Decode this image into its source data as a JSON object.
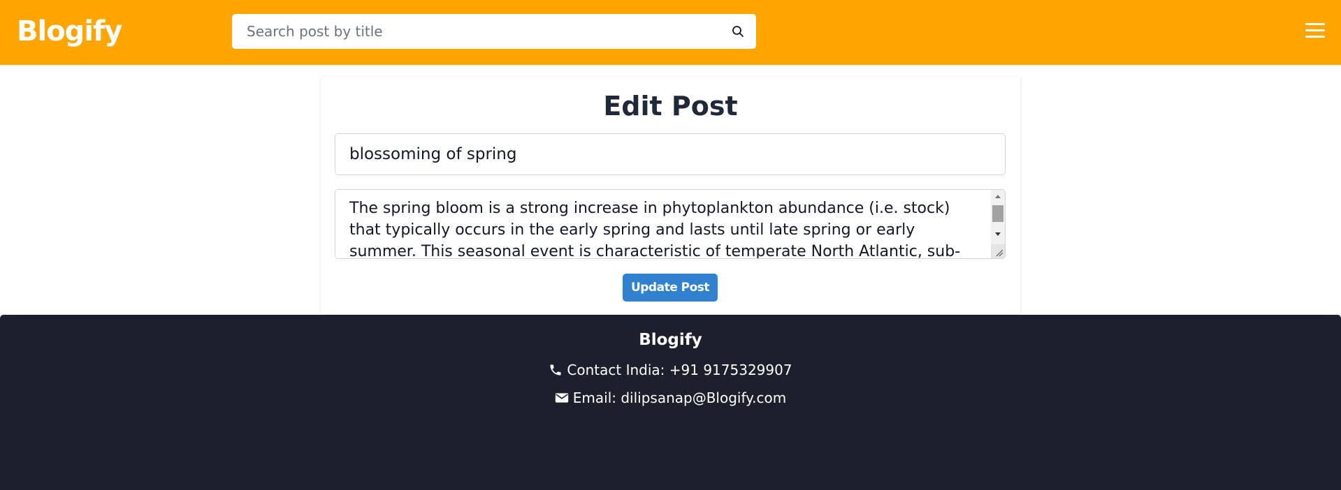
{
  "header": {
    "logo": "Blogify",
    "search_placeholder": "Search post by title",
    "icons": {
      "search": "search-icon",
      "menu": "hamburger-menu-icon"
    }
  },
  "edit_form": {
    "heading": "Edit Post",
    "title_value": "blossoming of spring",
    "content_value": "The spring bloom is a strong increase in phytoplankton abundance (i.e. stock) that typically occurs in the early spring and lasts until late spring or early summer. This seasonal event is characteristic of temperate North Atlantic, sub-polar, and coastal waters.",
    "submit_label": "Update Post"
  },
  "footer": {
    "brand": "Blogify",
    "contact": "Contact India: +91 9175329907",
    "email": "Email: dilipsanap@Blogify.com",
    "icons": {
      "contact": "phone-icon",
      "email": "envelope-icon"
    }
  },
  "colors": {
    "header_bg": "#ffa500",
    "button_bg": "#3182ce",
    "footer_bg": "#1c202d"
  }
}
